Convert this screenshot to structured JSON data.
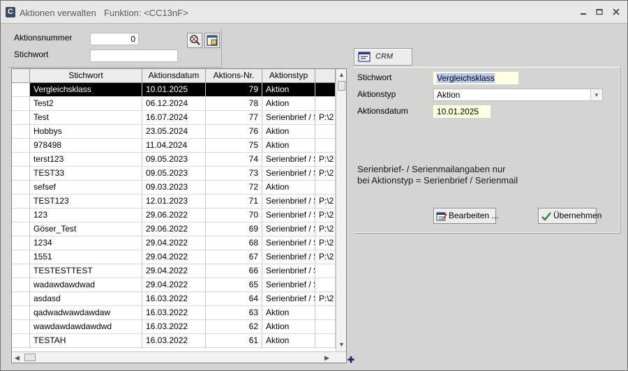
{
  "window": {
    "title": "Aktionen verwalten",
    "function_label": "Funktion: <CC13nF>",
    "app_icon_letter": "C"
  },
  "search": {
    "aktionsnummer_label": "Aktionsnummer",
    "aktionsnummer_value": "0",
    "stichwort_label": "Stichwort",
    "stichwort_value": ""
  },
  "grid": {
    "columns": [
      "Stichwort",
      "Aktionsdatum",
      "Aktions-Nr.",
      "Aktionstyp",
      ""
    ],
    "rows": [
      [
        "Vergleichsklass",
        "10.01.2025",
        "79",
        "Aktion",
        ""
      ],
      [
        "Test2",
        "06.12.2024",
        "78",
        "Aktion",
        ""
      ],
      [
        "Test",
        "16.07.2024",
        "77",
        "Serienbrief / S",
        "P:\\2"
      ],
      [
        "Hobbys",
        "23.05.2024",
        "76",
        "Aktion",
        ""
      ],
      [
        "978498",
        "11.04.2024",
        "75",
        "Aktion",
        ""
      ],
      [
        "terst123",
        "09.05.2023",
        "74",
        "Serienbrief / S",
        "P:\\2"
      ],
      [
        "TEST33",
        "09.05.2023",
        "73",
        "Serienbrief / S",
        "P:\\2"
      ],
      [
        "sefsef",
        "09.03.2023",
        "72",
        "Aktion",
        ""
      ],
      [
        "TEST123",
        "12.01.2023",
        "71",
        "Serienbrief / S",
        "P:\\2"
      ],
      [
        "123",
        "29.06.2022",
        "70",
        "Serienbrief / S",
        "P:\\2"
      ],
      [
        "Göser_Test",
        "29.06.2022",
        "69",
        "Serienbrief / S",
        "P:\\2"
      ],
      [
        "1234",
        "29.04.2022",
        "68",
        "Serienbrief / S",
        "P:\\2"
      ],
      [
        "1551",
        "29.04.2022",
        "67",
        "Serienbrief / S",
        "P:\\2"
      ],
      [
        "TESTESTTEST",
        "29.04.2022",
        "66",
        "Serienbrief / S",
        ""
      ],
      [
        "wadawdawdwad",
        "29.04.2022",
        "65",
        "Serienbrief / S",
        ""
      ],
      [
        "asdasd",
        "16.03.2022",
        "64",
        "Serienbrief / S",
        "P:\\2"
      ],
      [
        "qadwadwawdawdaw",
        "16.03.2022",
        "63",
        "Aktion",
        ""
      ],
      [
        "wawdawdawdawdwd",
        "16.03.2022",
        "62",
        "Aktion",
        ""
      ],
      [
        "TESTAH",
        "16.03.2022",
        "61",
        "Aktion",
        ""
      ]
    ],
    "selected_row": 0
  },
  "detail": {
    "tab_label": "CRM",
    "stichwort_label": "Stichwort",
    "stichwort_value": "Vergleichsklass",
    "aktionstyp_label": "Aktionstyp",
    "aktionstyp_value": "Aktion",
    "aktionsdatum_label": "Aktionsdatum",
    "aktionsdatum_value": "10.01.2025",
    "note_line1": "Serienbrief- / Serienmailangaben nur",
    "note_line2": "bei Aktionstyp = Serienbrief / Serienmail",
    "edit_button": "Bearbeiten ...",
    "apply_button": "Übernehmen"
  },
  "colors": {
    "selection": "#000000",
    "field_highlight": "#ffffe1",
    "window_bg": "#d4d4d4"
  }
}
